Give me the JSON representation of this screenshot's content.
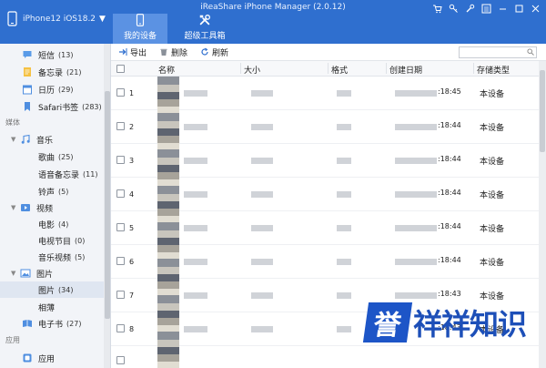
{
  "app": {
    "title": "iReaShare iPhone Manager (2.0.12)",
    "device_label": "iPhone12 iOS18.2",
    "dropdown_glyph": "▼"
  },
  "main_tabs": [
    {
      "label": "我的设备",
      "icon": "phone-icon",
      "active": true
    },
    {
      "label": "超级工具箱",
      "icon": "tools-icon",
      "active": false
    }
  ],
  "window_controls": [
    "cart-icon",
    "key-icon",
    "wrench-icon",
    "menu-icon",
    "minimize-icon",
    "maximize-icon",
    "close-icon"
  ],
  "sidebar": {
    "sections": [
      "媒体",
      "应用"
    ],
    "items": [
      {
        "label": "短信",
        "count": "(13)",
        "icon": "sms-icon"
      },
      {
        "label": "备忘录",
        "count": "(21)",
        "icon": "notes-icon"
      },
      {
        "label": "日历",
        "count": "(29)",
        "icon": "calendar-icon"
      },
      {
        "label": "Safari书签",
        "count": "(283)",
        "icon": "bookmark-icon"
      },
      {
        "label": "音乐",
        "count": "",
        "icon": "music-icon"
      },
      {
        "label": "歌曲",
        "count": "(25)"
      },
      {
        "label": "语音备忘录",
        "count": "(11)"
      },
      {
        "label": "铃声",
        "count": "(5)"
      },
      {
        "label": "视频",
        "count": "",
        "icon": "video-icon"
      },
      {
        "label": "电影",
        "count": "(4)"
      },
      {
        "label": "电视节目",
        "count": "(0)"
      },
      {
        "label": "音乐视频",
        "count": "(5)"
      },
      {
        "label": "图片",
        "count": "",
        "icon": "picture-icon"
      },
      {
        "label": "图片",
        "count": "(34)"
      },
      {
        "label": "相薄",
        "count": ""
      },
      {
        "label": "电子书",
        "count": "(27)",
        "icon": "ebook-icon"
      },
      {
        "label": "应用",
        "count": "",
        "icon": "apps-icon"
      }
    ]
  },
  "toolbar": {
    "export_label": "导出",
    "delete_label": "删除",
    "refresh_label": "刷新",
    "search_placeholder": ""
  },
  "table": {
    "columns": [
      "名称",
      "大小",
      "格式",
      "创建日期",
      "存储类型"
    ],
    "rows": [
      {
        "index": "1",
        "time": ":18:45",
        "storage": "本设备"
      },
      {
        "index": "2",
        "time": ":18:44",
        "storage": "本设备"
      },
      {
        "index": "3",
        "time": ":18:44",
        "storage": "本设备"
      },
      {
        "index": "4",
        "time": ":18:44",
        "storage": "本设备"
      },
      {
        "index": "5",
        "time": ":18:44",
        "storage": "本设备"
      },
      {
        "index": "6",
        "time": ":18:44",
        "storage": "本设备"
      },
      {
        "index": "7",
        "time": ":18:43",
        "storage": "本设备"
      },
      {
        "index": "8",
        "time": ":18:43",
        "storage": "本设备"
      }
    ]
  },
  "watermark": {
    "badge": "誉",
    "text": "祥祥知识"
  },
  "colors": {
    "titlebar": "#2f6fcf",
    "active_tab": "#5b92e3",
    "watermark": "#1d55c7"
  }
}
